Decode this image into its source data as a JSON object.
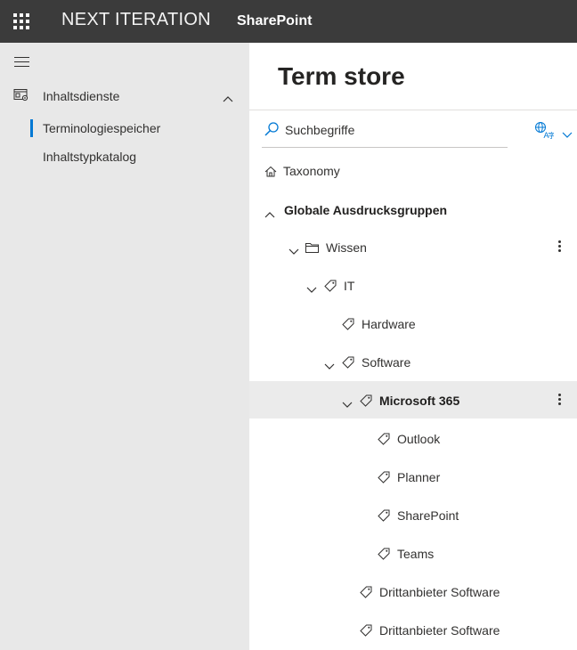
{
  "topbar": {
    "brand": "NEXT ITERATION",
    "app_name": "SharePoint",
    "background": "#3b3b3b"
  },
  "leftnav": {
    "group": {
      "label": "Inhaltsdienste",
      "icon": "content-services-icon",
      "expanded": true
    },
    "items": [
      {
        "label": "Terminologiespeicher",
        "selected": true
      },
      {
        "label": "Inhaltstypkatalog",
        "selected": false
      }
    ],
    "accent": "#0078d4"
  },
  "main": {
    "title": "Term store",
    "search": {
      "placeholder": "Suchbegriffe",
      "value": ""
    },
    "language_button": {
      "icon": "globe-language-icon"
    },
    "tree": [
      {
        "label": "Taxonomy",
        "icon": "home-icon",
        "level": 0
      },
      {
        "label": "Globale Ausdrucksgruppen",
        "level": 0,
        "expanded": true,
        "bold": true
      },
      {
        "label": "Wissen",
        "icon": "folder-icon",
        "level": 1,
        "expanded": true,
        "has_more": true
      },
      {
        "label": "IT",
        "icon": "tag-icon",
        "level": 2,
        "expanded": true
      },
      {
        "label": "Hardware",
        "icon": "tag-icon",
        "level": 3
      },
      {
        "label": "Software",
        "icon": "tag-icon",
        "level": 3,
        "expanded": true
      },
      {
        "label": "Microsoft 365",
        "icon": "tag-icon",
        "level": 4,
        "expanded": true,
        "selected": true,
        "bold": true,
        "has_more": true
      },
      {
        "label": "Outlook",
        "icon": "tag-icon",
        "level": 5
      },
      {
        "label": "Planner",
        "icon": "tag-icon",
        "level": 5
      },
      {
        "label": "SharePoint",
        "icon": "tag-icon",
        "level": 5
      },
      {
        "label": "Teams",
        "icon": "tag-icon",
        "level": 5
      },
      {
        "label": "Drittanbieter Software",
        "icon": "tag-icon",
        "level": 4
      },
      {
        "label": "Drittanbieter Software",
        "icon": "tag-icon",
        "level": 4
      }
    ]
  }
}
